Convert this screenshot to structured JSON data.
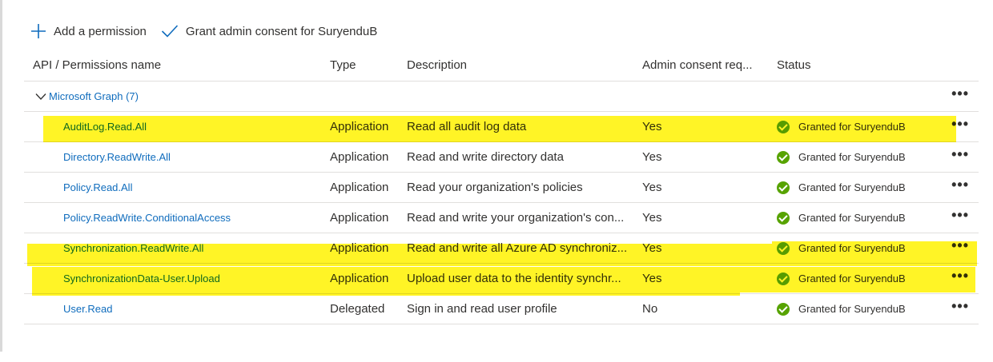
{
  "toolbar": {
    "add_label": "Add a permission",
    "grant_label": "Grant admin consent for SuryenduB"
  },
  "columns": {
    "name": "API / Permissions name",
    "type": "Type",
    "description": "Description",
    "admin": "Admin consent req...",
    "status": "Status"
  },
  "group": {
    "label": "Microsoft Graph (7)"
  },
  "rows": [
    {
      "name": "AuditLog.Read.All",
      "type": "Application",
      "description": "Read all audit log data",
      "admin": "Yes",
      "status": "Granted for SuryenduB"
    },
    {
      "name": "Directory.ReadWrite.All",
      "type": "Application",
      "description": "Read and write directory data",
      "admin": "Yes",
      "status": "Granted for SuryenduB"
    },
    {
      "name": "Policy.Read.All",
      "type": "Application",
      "description": "Read your organization's policies",
      "admin": "Yes",
      "status": "Granted for SuryenduB"
    },
    {
      "name": "Policy.ReadWrite.ConditionalAccess",
      "type": "Application",
      "description": "Read and write your organization's con...",
      "admin": "Yes",
      "status": "Granted for SuryenduB"
    },
    {
      "name": "Synchronization.ReadWrite.All",
      "type": "Application",
      "description": "Read and write all Azure AD synchroniz...",
      "admin": "Yes",
      "status": "Granted for SuryenduB"
    },
    {
      "name": "SynchronizationData-User.Upload",
      "type": "Application",
      "description": "Upload user data to the identity synchr...",
      "admin": "Yes",
      "status": "Granted for SuryenduB"
    },
    {
      "name": "User.Read",
      "type": "Delegated",
      "description": "Sign in and read user profile",
      "admin": "No",
      "status": "Granted for SuryenduB"
    }
  ],
  "more_glyph": "•••",
  "icons": {
    "add": "plus-icon",
    "grant": "checkmark-icon",
    "expand": "chevron-down-icon",
    "status": "granted-check-icon",
    "more": "more-options-icon"
  },
  "colors": {
    "link": "#0f6cbd",
    "granted": "#57a300",
    "highlight": "#fff200"
  }
}
